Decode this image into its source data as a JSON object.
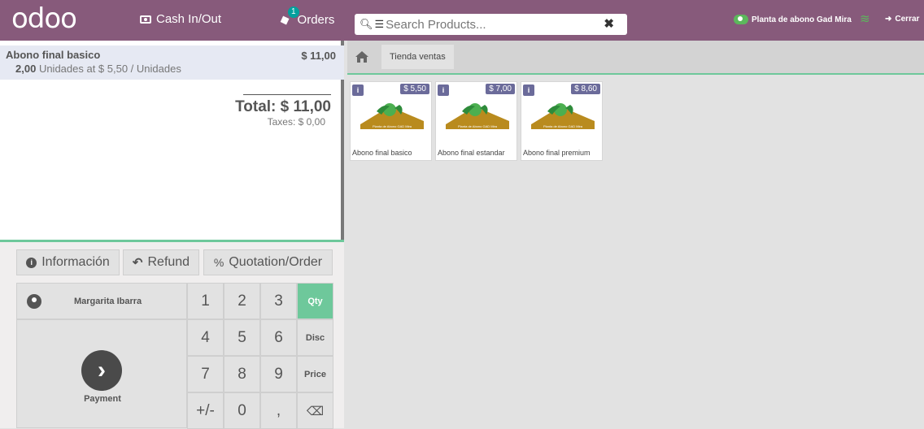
{
  "header": {
    "logo": "odoo",
    "cash_label": "Cash In/Out",
    "orders_label": "Orders",
    "orders_badge": "1",
    "search_placeholder": "Search Products...",
    "config_label": "Planta de abono Gad Mira",
    "close_label": "Cerrar"
  },
  "order": {
    "line": {
      "name": "Abono final basico",
      "price": "$ 11,00",
      "qty": "2,00",
      "qty_detail": "Unidades at $ 5,50 / Unidades"
    },
    "total": "Total: $ 11,00",
    "taxes": "Taxes: $ 0,00"
  },
  "controls": {
    "info": "Información",
    "refund": "Refund",
    "quotation": "Quotation/Order"
  },
  "customer": "Margarita Ibarra",
  "payment_label": "Payment",
  "numpad": {
    "k1": "1",
    "k2": "2",
    "k3": "3",
    "k4": "4",
    "k5": "5",
    "k6": "6",
    "k7": "7",
    "k8": "8",
    "k9": "9",
    "kpm": "+/-",
    "k0": "0",
    "kdot": ",",
    "qty": "Qty",
    "disc": "Disc",
    "price": "Price"
  },
  "category": "Tienda ventas",
  "products": [
    {
      "name": "Abono final basico",
      "price": "$ 5,50"
    },
    {
      "name": "Abono final estandar",
      "price": "$ 7,00"
    },
    {
      "name": "Abono final premium",
      "price": "$ 8,60"
    }
  ],
  "product_image_text": "Planta de Abono GAD Mira",
  "colors": {
    "brand": "#875a7b",
    "accent": "#6ec89b",
    "price_tag": "#6b6b9a"
  }
}
